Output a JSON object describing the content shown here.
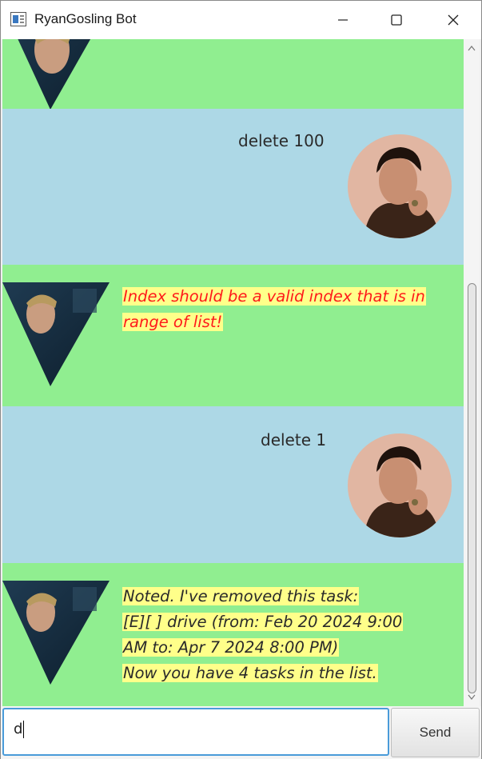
{
  "window": {
    "title": "RyanGosling Bot"
  },
  "messages": [
    {
      "sender": "user",
      "text": "delete 100"
    },
    {
      "sender": "bot",
      "type": "error",
      "lines": [
        "Index should be a valid index that is in",
        "range of list!"
      ]
    },
    {
      "sender": "user",
      "text": "delete 1"
    },
    {
      "sender": "bot",
      "type": "normal",
      "lines": [
        "Noted. I've removed this task:",
        "[E][ ] drive (from: Feb 20 2024 9:00",
        "AM to: Apr 7 2024 8:00 PM)",
        "Now you have 4 tasks in the list."
      ]
    }
  ],
  "input": {
    "value": "d"
  },
  "send_button": {
    "label": "Send"
  },
  "colors": {
    "bot_bg": "#90ee90",
    "user_bg": "#add8e6",
    "error_text": "#ff0000",
    "highlight": "#ffff8a"
  },
  "icons": {
    "app": "app-window-icon",
    "minimize": "minimize-icon",
    "maximize": "maximize-icon",
    "close": "close-icon"
  }
}
